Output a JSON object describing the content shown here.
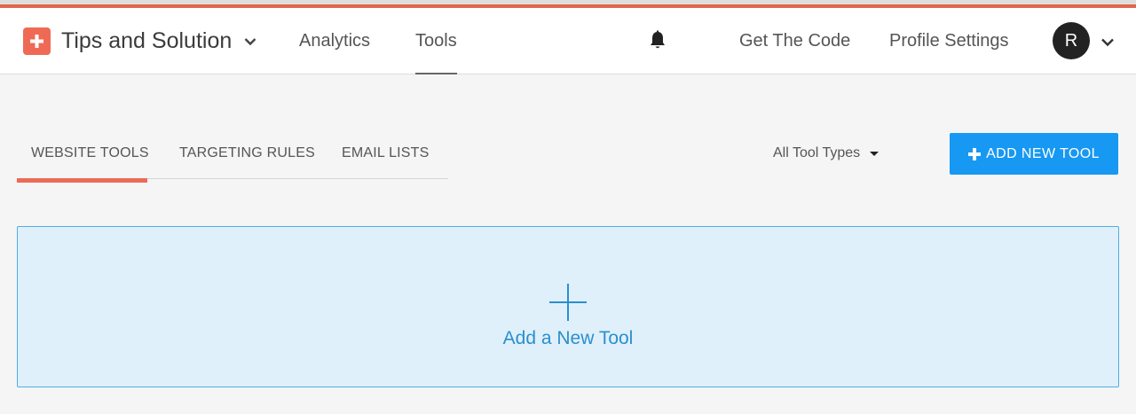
{
  "colors": {
    "accent": "#e0664f",
    "brand_logo": "#ef6a55",
    "primary_button": "#1798f2",
    "card_background": "#dff0fb",
    "card_border": "#51aede",
    "card_text": "#2a8fce"
  },
  "header": {
    "brand_icon": "plus-square-icon",
    "brand_name": "Tips and Solution",
    "brand_caret_icon": "chevron-down-icon",
    "nav": {
      "analytics": "Analytics",
      "tools": "Tools",
      "active": "Tools"
    },
    "notification_icon": "bell-icon",
    "get_code": "Get The Code",
    "profile_settings": "Profile Settings",
    "avatar_initial": "R",
    "avatar_caret_icon": "chevron-down-icon"
  },
  "tabs": {
    "items": [
      "WEBSITE TOOLS",
      "TARGETING RULES",
      "EMAIL LISTS"
    ],
    "active": "WEBSITE TOOLS"
  },
  "filter": {
    "label": "All Tool Types",
    "caret_icon": "caret-down-icon"
  },
  "toolbar": {
    "add_icon": "plus-icon",
    "add_label": "ADD NEW TOOL"
  },
  "add_card": {
    "icon": "plus-icon",
    "label": "Add a New Tool"
  }
}
